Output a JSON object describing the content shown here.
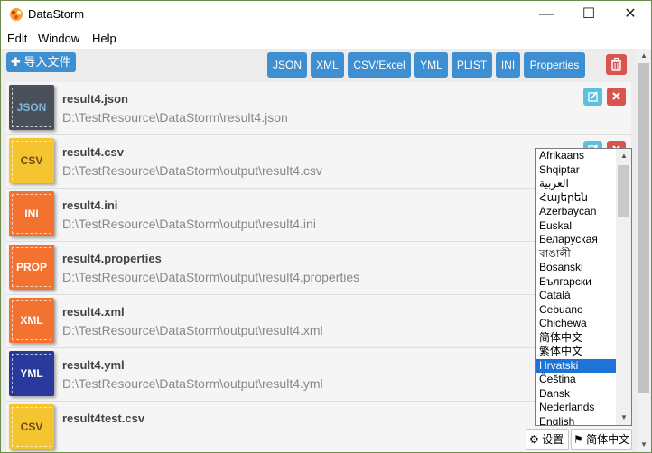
{
  "window": {
    "title": "DataStorm",
    "minimize": "—",
    "maximize": "☐",
    "close": "✕"
  },
  "menu": [
    "Edit",
    "Window",
    "Help"
  ],
  "toolbar": {
    "import_label": "导入文件",
    "formats": [
      "JSON",
      "XML",
      "CSV/Excel",
      "YML",
      "PLIST",
      "INI",
      "Properties"
    ]
  },
  "files": [
    {
      "badge": "JSON",
      "name": "result4.json",
      "path": "D:\\TestResource\\DataStorm\\result4.json",
      "color": "#4a5059",
      "text_color": "#7fb4d8"
    },
    {
      "badge": "CSV",
      "name": "result4.csv",
      "path": "D:\\TestResource\\DataStorm\\output\\result4.csv",
      "color": "#f5c431",
      "text_color": "#6b4a1a"
    },
    {
      "badge": "INI",
      "name": "result4.ini",
      "path": "D:\\TestResource\\DataStorm\\output\\result4.ini",
      "color": "#f47230",
      "text_color": "#ffffff"
    },
    {
      "badge": "PROP",
      "name": "result4.properties",
      "path": "D:\\TestResource\\DataStorm\\output\\result4.properties",
      "color": "#f47230",
      "text_color": "#ffffff"
    },
    {
      "badge": "XML",
      "name": "result4.xml",
      "path": "D:\\TestResource\\DataStorm\\output\\result4.xml",
      "color": "#f47230",
      "text_color": "#ffffff"
    },
    {
      "badge": "YML",
      "name": "result4.yml",
      "path": "D:\\TestResource\\DataStorm\\output\\result4.yml",
      "color": "#2a3a9c",
      "text_color": "#ffffff"
    },
    {
      "badge": "CSV",
      "name": "result4test.csv",
      "path": "",
      "color": "#f5c431",
      "text_color": "#6b4a1a"
    }
  ],
  "languages": [
    "Afrikaans",
    "Shqiptar",
    "العربية",
    "Հայերեն",
    "Azerbaycan",
    "Euskal",
    "Беларуская",
    "বাঙালী",
    "Bosanski",
    "Български",
    "Català",
    "Cebuano",
    "Chichewa",
    "简体中文",
    "繁体中文",
    "Hrvatski",
    "Čeština",
    "Dansk",
    "Nederlands",
    "English"
  ],
  "selected_language": "Hrvatski",
  "footer": {
    "settings_label": "设置",
    "language_label": "简体中文"
  },
  "colors": {
    "primary": "#3e8fd1",
    "danger": "#d9534f",
    "info": "#5bc0de",
    "selection": "#1e73d6"
  }
}
